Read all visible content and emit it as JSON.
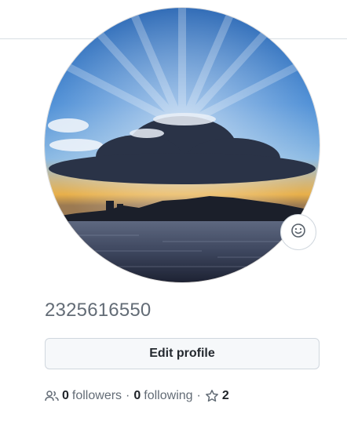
{
  "profile": {
    "username": "2325616550",
    "edit_label": "Edit profile",
    "status_icon": "smiley-icon",
    "avatar_alt": "avatar"
  },
  "stats": {
    "followers_icon": "people-icon",
    "followers_count": "0",
    "followers_label": "followers",
    "separator": "·",
    "following_count": "0",
    "following_label": "following",
    "stars_icon": "star-icon",
    "stars_count": "2"
  },
  "colors": {
    "muted_text": "#636c76",
    "primary_text": "#1f2328",
    "border": "#d0d7de",
    "button_bg": "#f6f8fa"
  }
}
